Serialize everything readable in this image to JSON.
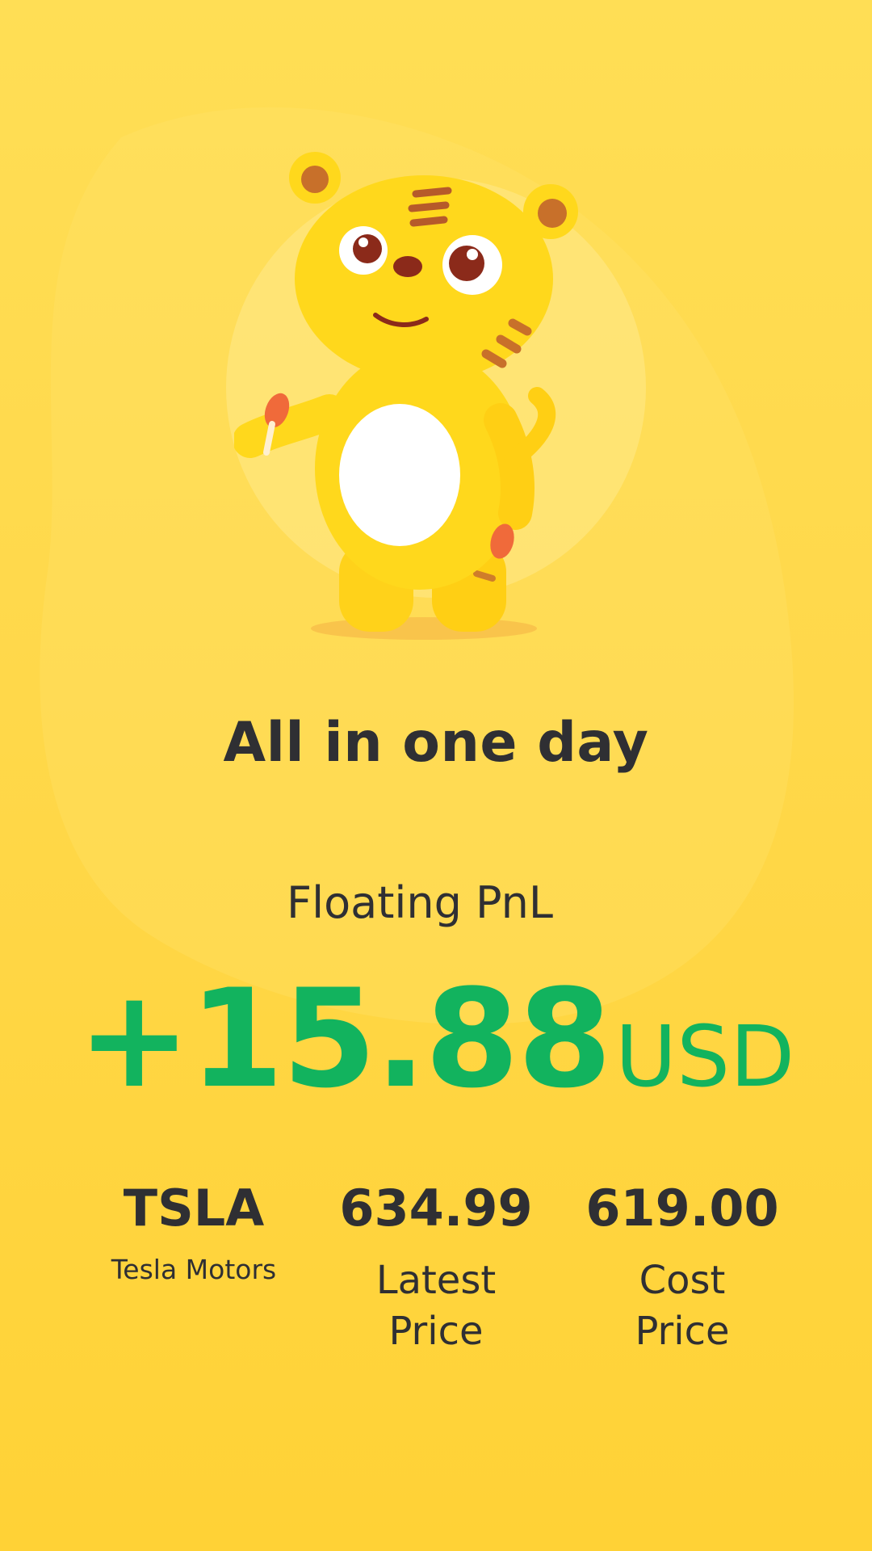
{
  "headline": "All in one day",
  "pnl": {
    "label": "Floating PnL",
    "amount": "+15.88",
    "unit": "USD",
    "color": "#12b35e"
  },
  "stats": {
    "ticker": "TSLA",
    "company": "Tesla Motors",
    "latest_price": "634.99",
    "latest_price_label": "Latest Price",
    "cost_price": "619.00",
    "cost_price_label": "Cost Price"
  },
  "mascot": {
    "icon": "tiger-mascot-icon"
  },
  "colors": {
    "background": "#ffd84a",
    "text": "#2f2f33",
    "profit": "#12b35e"
  }
}
